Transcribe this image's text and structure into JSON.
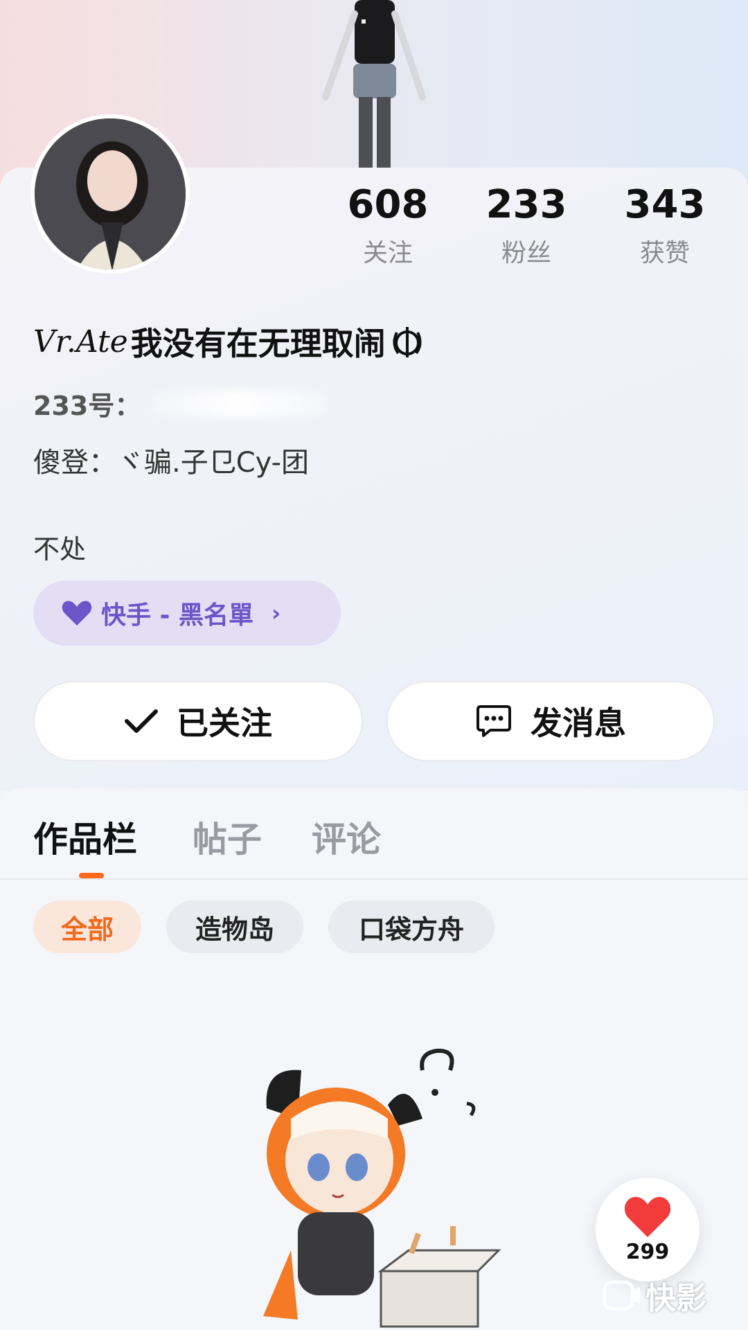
{
  "profile": {
    "nickname_script": "Vr.Ate",
    "nickname": "我没有在无理取闹",
    "id_label": "233号：",
    "alias": "傻登：ヾ骗.子⺋Cy-团",
    "bio": "不处"
  },
  "stats": [
    {
      "value": "608",
      "label": "关注"
    },
    {
      "value": "233",
      "label": "粉丝"
    },
    {
      "value": "343",
      "label": "获赞"
    }
  ],
  "tag_pill": {
    "label": "快手 - 黑名單",
    "icon": "heart-icon"
  },
  "buttons": {
    "follow": "已关注",
    "message": "发消息"
  },
  "tabs": [
    "作品栏",
    "帖子",
    "评论"
  ],
  "filters": [
    "全部",
    "造物岛",
    "口袋方舟"
  ],
  "like_float": {
    "count": "299"
  },
  "watermark": "快影",
  "colors": {
    "accent": "#ff6a1a",
    "tag_purple": "#6a55c9",
    "heart_red": "#f23b3b"
  }
}
